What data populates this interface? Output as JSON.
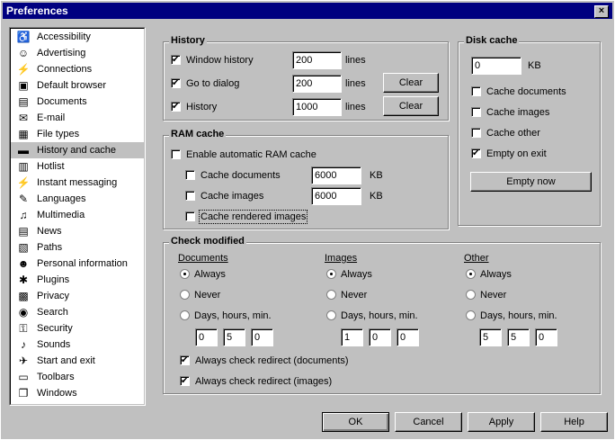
{
  "window": {
    "title": "Preferences",
    "close_glyph": "×"
  },
  "sidebar": {
    "items": [
      {
        "label": "Accessibility",
        "icon": "accessibility-icon",
        "glyph": "♿"
      },
      {
        "label": "Advertising",
        "icon": "smiley-icon",
        "glyph": "☺"
      },
      {
        "label": "Connections",
        "icon": "plug-icon",
        "glyph": "⚡"
      },
      {
        "label": "Default browser",
        "icon": "browser-icon",
        "glyph": "▣"
      },
      {
        "label": "Documents",
        "icon": "document-icon",
        "glyph": "▤"
      },
      {
        "label": "E-mail",
        "icon": "envelope-icon",
        "glyph": "✉"
      },
      {
        "label": "File types",
        "icon": "folder-icon",
        "glyph": "▦"
      },
      {
        "label": "History and cache",
        "icon": "disk-icon",
        "glyph": "▬",
        "selected": true
      },
      {
        "label": "Hotlist",
        "icon": "hotlist-icon",
        "glyph": "▥"
      },
      {
        "label": "Instant messaging",
        "icon": "lightning-icon",
        "glyph": "⚡"
      },
      {
        "label": "Languages",
        "icon": "speech-icon",
        "glyph": "✎"
      },
      {
        "label": "Multimedia",
        "icon": "multimedia-icon",
        "glyph": "♫"
      },
      {
        "label": "News",
        "icon": "news-icon",
        "glyph": "▤"
      },
      {
        "label": "Paths",
        "icon": "paths-icon",
        "glyph": "▧"
      },
      {
        "label": "Personal information",
        "icon": "person-icon",
        "glyph": "☻"
      },
      {
        "label": "Plugins",
        "icon": "plugin-icon",
        "glyph": "✱"
      },
      {
        "label": "Privacy",
        "icon": "privacy-icon",
        "glyph": "▩"
      },
      {
        "label": "Search",
        "icon": "globe-icon",
        "glyph": "◉"
      },
      {
        "label": "Security",
        "icon": "key-icon",
        "glyph": "⚿"
      },
      {
        "label": "Sounds",
        "icon": "speaker-icon",
        "glyph": "♪"
      },
      {
        "label": "Start and exit",
        "icon": "start-icon",
        "glyph": "✈"
      },
      {
        "label": "Toolbars",
        "icon": "toolbar-icon",
        "glyph": "▭"
      },
      {
        "label": "Windows",
        "icon": "windows-icon",
        "glyph": "❐"
      }
    ]
  },
  "history": {
    "title": "History",
    "window_history": {
      "label": "Window history",
      "checked": true,
      "value": "200",
      "unit": "lines"
    },
    "goto_dialog": {
      "label": "Go to dialog",
      "checked": true,
      "value": "200",
      "unit": "lines",
      "clear": "Clear"
    },
    "history": {
      "label": "History",
      "checked": true,
      "value": "1000",
      "unit": "lines",
      "clear": "Clear"
    }
  },
  "disk_cache": {
    "title": "Disk cache",
    "size": {
      "value": "0",
      "unit": "KB"
    },
    "cache_documents": {
      "label": "Cache documents",
      "checked": false
    },
    "cache_images": {
      "label": "Cache images",
      "checked": false
    },
    "cache_other": {
      "label": "Cache other",
      "checked": false
    },
    "empty_on_exit": {
      "label": "Empty on exit",
      "checked": true
    },
    "empty_now": "Empty now"
  },
  "ram_cache": {
    "title": "RAM cache",
    "enable": {
      "label": "Enable automatic RAM cache",
      "checked": false
    },
    "cache_documents": {
      "label": "Cache documents",
      "checked": false,
      "value": "6000",
      "unit": "KB"
    },
    "cache_images": {
      "label": "Cache images",
      "checked": false,
      "value": "6000",
      "unit": "KB"
    },
    "cache_rendered": {
      "label": "Cache rendered images",
      "checked": false
    }
  },
  "check_modified": {
    "title": "Check modified",
    "columns": [
      {
        "heading": "Documents",
        "always": "Always",
        "never": "Never",
        "days": "Days, hours, min.",
        "selected": "always",
        "values": [
          "0",
          "5",
          "0"
        ]
      },
      {
        "heading": "Images",
        "always": "Always",
        "never": "Never",
        "days": "Days, hours, min.",
        "selected": "always",
        "values": [
          "1",
          "0",
          "0"
        ]
      },
      {
        "heading": "Other",
        "always": "Always",
        "never": "Never",
        "days": "Days, hours, min.",
        "selected": "always",
        "values": [
          "5",
          "5",
          "0"
        ]
      }
    ],
    "redirect_documents": {
      "label": "Always check redirect (documents)",
      "checked": true
    },
    "redirect_images": {
      "label": "Always check redirect (images)",
      "checked": true
    }
  },
  "footer": {
    "ok": "OK",
    "cancel": "Cancel",
    "apply": "Apply",
    "help": "Help"
  }
}
